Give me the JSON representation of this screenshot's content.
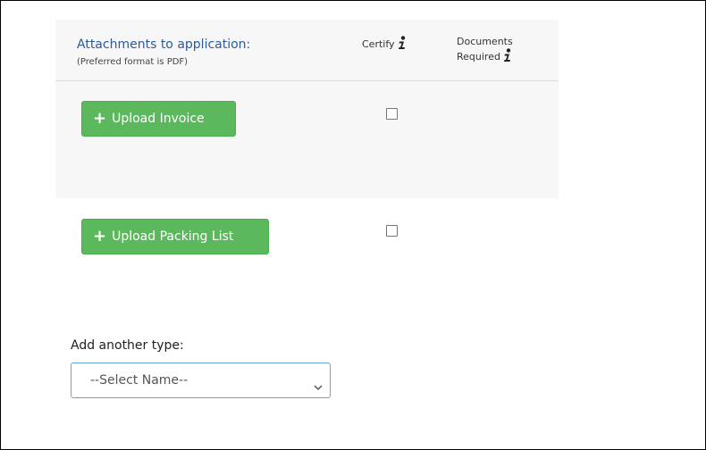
{
  "attachments": {
    "title": "Attachments to application:",
    "subtitle": "(Preferred format is PDF)",
    "columns": {
      "certify": "Certify",
      "documents_required_line1": "Documents",
      "documents_required_line2": "Required"
    },
    "rows": [
      {
        "button_label": "Upload Invoice",
        "certified": false
      },
      {
        "button_label": "Upload Packing List",
        "certified": false
      }
    ],
    "add_another": {
      "label": "Add another type:",
      "select_value": "--Select Name--"
    }
  },
  "icons": {
    "info": "info-icon",
    "plus": "plus-icon",
    "dropdown": "chevron-down-icon"
  },
  "colors": {
    "title_blue": "#2c5a9a",
    "button_green": "#5cb85c",
    "select_border": "#66a3e0"
  }
}
